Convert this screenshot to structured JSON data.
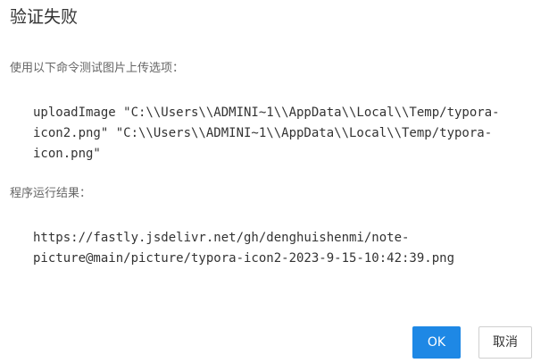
{
  "dialog": {
    "title": "验证失败",
    "command_label": "使用以下命令测试图片上传选项：",
    "command_lines": [
      "uploadImage \"C:\\\\Users\\\\ADMINI~1\\\\AppData\\\\Local\\\\Temp/typora-",
      "icon2.png\" \"C:\\\\Users\\\\ADMINI~1\\\\AppData\\\\Local\\\\Temp/typora-",
      "icon.png\""
    ],
    "result_label": "程序运行结果：",
    "result_lines": [
      "https://fastly.jsdelivr.net/gh/denghuishenmi/note-",
      "picture@main/picture/typora-icon2-2023-9-15-10:42:39.png"
    ],
    "ok_label": "OK",
    "cancel_label": "取消"
  },
  "colors": {
    "primary_button": "#1e88e5",
    "title_text": "#333333",
    "label_text": "#666666"
  }
}
